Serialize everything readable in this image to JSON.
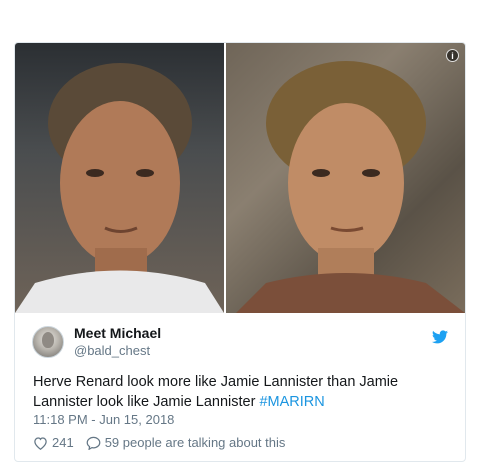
{
  "tweet": {
    "author": {
      "display_name": "Meet Michael",
      "handle": "@bald_chest",
      "avatar_icon": "avatar-photo"
    },
    "text_plain": "Herve Renard look more like Jamie Lannister than Jamie Lannister look like Jamie Lannister ",
    "hashtag": "#MARIRN",
    "timestamp": "11:18 PM - Jun 15, 2018",
    "likes_count": "241",
    "conversation_text": "59 people are talking about this",
    "info_symbol": "i",
    "icons": {
      "brand": "twitter-bird-icon",
      "like": "heart-icon",
      "reply": "speech-bubble-icon",
      "info": "info-icon"
    },
    "colors": {
      "link": "#1b95e0",
      "secondary_text": "#657786",
      "border": "#e1e8ed",
      "brand_blue": "#1da1f2"
    }
  }
}
